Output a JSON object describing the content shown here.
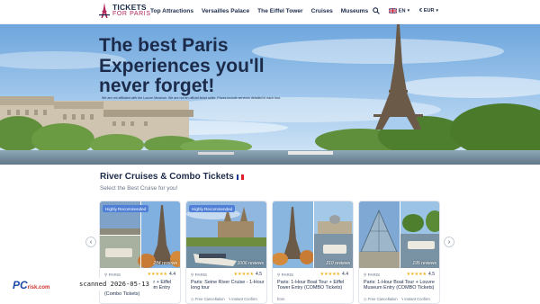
{
  "header": {
    "logo_line1": "TICKETS",
    "logo_line2": "FOR PARIS",
    "nav": [
      "Top Attractions",
      "Versailles Palace",
      "The Eiffel Tower",
      "Cruises",
      "Museums"
    ],
    "language": "EN",
    "currency": "€ EUR",
    "icons": [
      "search-icon",
      "uk-flag-icon"
    ]
  },
  "hero": {
    "title_line1": "The best Paris",
    "title_line2": "Experiences you'll",
    "title_line3": "never forget!",
    "note": "We are not affiliated with the Louvre Museum. We are not an official ticket seller. Prices include services detailed in each tour."
  },
  "section": {
    "title": "River Cruises & Combo Tickets",
    "subtitle": "Select the Best Cruise for you!"
  },
  "cards": [
    {
      "badge": "Highly Recommended",
      "reviews": "284 reviews",
      "location": "PARIS",
      "stars": "★★★★★",
      "rating": "4.4",
      "title": "Paris: 1-Hour Boat Tour + Eiffel Tower + Louvre Museum Entry (Combo Tickets)",
      "feature1": "",
      "feature2": ""
    },
    {
      "badge": "Highly Recommended",
      "reviews": "1006 reviews",
      "location": "PARIS",
      "stars": "★★★★★",
      "rating": "4.5",
      "title": "Paris: Seine River Cruise - 1-Hour long tour",
      "feature1": "Free Cancellation",
      "feature2": "Instant Confirm"
    },
    {
      "badge": "",
      "reviews": "210 reviews",
      "location": "PARIS",
      "stars": "★★★★★",
      "rating": "4.4",
      "title": "Paris: 1-Hour Boat Tour + Eiffel Tower Entry (COMBO Tickets)",
      "feature1": "from",
      "feature2": ""
    },
    {
      "badge": "",
      "reviews": "195 reviews",
      "location": "PARIS",
      "stars": "★★★★★",
      "rating": "4.5",
      "title": "Paris: 1-Hour Boat Tour + Louvre Museum Entry (COMBO Tickets)",
      "feature1": "Free Cancellation",
      "feature2": "Instant Confirm"
    }
  ],
  "overlay": {
    "watermark": "PC",
    "watermark_small": "risk.com",
    "scan": "scanned 2026-05-13"
  },
  "colors": {
    "navy": "#1c2b4a",
    "accent": "#b0265a",
    "badge": "#4f7fd6",
    "star": "#f2b01e"
  }
}
